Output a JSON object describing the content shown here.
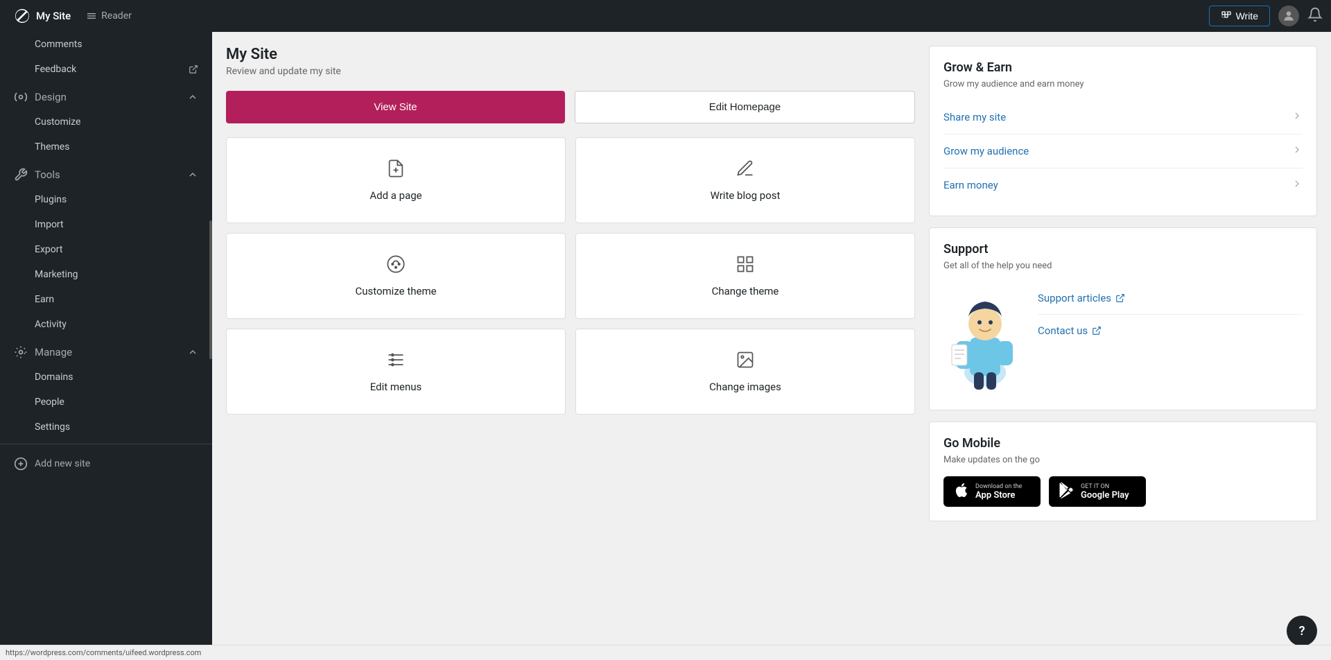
{
  "topNav": {
    "logo": "My Site",
    "logoIcon": "wordpress-icon",
    "reader": "Reader",
    "readerIcon": "reader-icon",
    "writeBtn": "Write",
    "writeIcon": "pencil-icon",
    "bellIcon": "bell-icon",
    "avatarIcon": "avatar-icon"
  },
  "sidebar": {
    "comments": "Comments",
    "feedback": "Feedback",
    "feedbackExternalIcon": "external-link-icon",
    "design": "Design",
    "designChevronIcon": "chevron-up-icon",
    "designIcon": "design-icon",
    "customize": "Customize",
    "themes": "Themes",
    "tools": "Tools",
    "toolsChevronIcon": "chevron-up-icon",
    "toolsIcon": "tools-icon",
    "plugins": "Plugins",
    "import": "Import",
    "export": "Export",
    "marketing": "Marketing",
    "earn": "Earn",
    "activity": "Activity",
    "manage": "Manage",
    "manageChevronIcon": "chevron-up-icon",
    "manageIcon": "manage-icon",
    "domains": "Domains",
    "people": "People",
    "settings": "Settings",
    "addNewSite": "Add new site",
    "addNewSiteIcon": "plus-circle-icon"
  },
  "main": {
    "title": "My Site",
    "subtitle": "Review and update my site",
    "viewSiteBtn": "View Site",
    "editHomepageBtn": "Edit Homepage",
    "cards": [
      {
        "id": "add-page",
        "icon": "add-page-icon",
        "label": "Add a page"
      },
      {
        "id": "write-blog",
        "icon": "write-blog-icon",
        "label": "Write blog post"
      },
      {
        "id": "customize-theme",
        "icon": "customize-theme-icon",
        "label": "Customize theme"
      },
      {
        "id": "change-theme",
        "icon": "change-theme-icon",
        "label": "Change theme"
      },
      {
        "id": "edit-menus",
        "icon": "edit-menus-icon",
        "label": "Edit menus"
      },
      {
        "id": "change-images",
        "icon": "change-images-icon",
        "label": "Change images"
      }
    ]
  },
  "growEarn": {
    "title": "Grow & Earn",
    "subtitle": "Grow my audience and earn money",
    "links": [
      {
        "id": "share-my-site",
        "label": "Share my site"
      },
      {
        "id": "grow-audience",
        "label": "Grow my audience"
      },
      {
        "id": "earn-money",
        "label": "Earn money"
      }
    ]
  },
  "support": {
    "title": "Support",
    "subtitle": "Get all of the help you need",
    "links": [
      {
        "id": "support-articles",
        "label": "Support articles",
        "icon": "external-link-icon"
      },
      {
        "id": "contact-us",
        "label": "Contact us",
        "icon": "external-link-icon"
      }
    ]
  },
  "goMobile": {
    "title": "Go Mobile",
    "subtitle": "Make updates on the go",
    "appStore": {
      "sub": "Download on the",
      "main": "App Store",
      "icon": "apple-icon"
    },
    "googlePlay": {
      "sub": "GET IT ON",
      "main": "Google Play",
      "icon": "google-play-icon"
    }
  },
  "helpBtn": "?",
  "statusBar": "https://wordpress.com/comments/uifeed.wordpress.com"
}
